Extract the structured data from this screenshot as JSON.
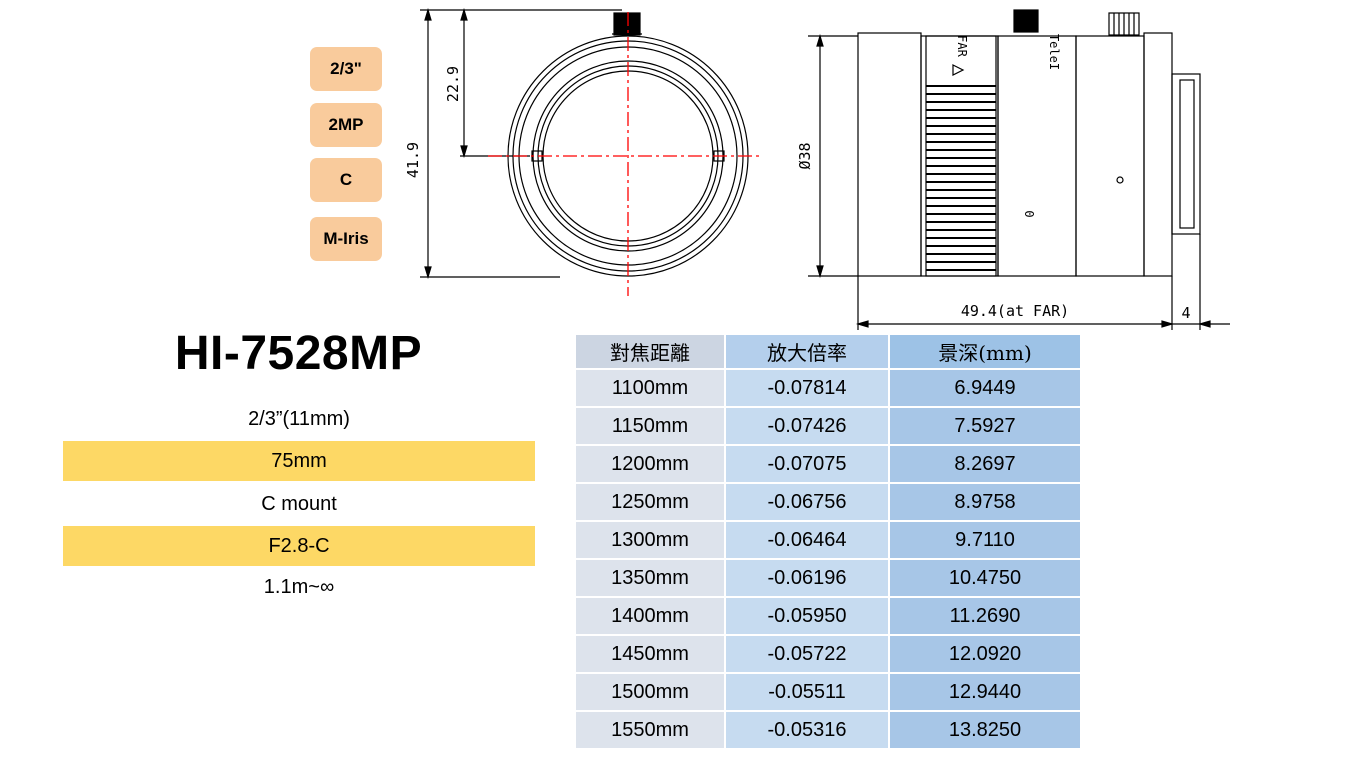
{
  "badges": [
    "2/3\"",
    "2MP",
    "C",
    "M-Iris"
  ],
  "model": "HI-7528MP",
  "specs": [
    "2/3”(11mm)",
    "75mm",
    "C mount",
    "F2.8-C",
    "1.1m~∞"
  ],
  "drawing": {
    "dim_height": "41.9",
    "dim_half_height": "22.9",
    "dim_diameter": "Ø38",
    "dim_length": "49.4(at FAR)",
    "dim_flange": "4",
    "focus_mark": "FAR",
    "iris_mark": "TeleI",
    "zero_mark": "0"
  },
  "table": {
    "headers": [
      "對焦距離",
      "放大倍率",
      "景深(mm)"
    ],
    "rows": [
      [
        "1100mm",
        "-0.07814",
        "6.9449"
      ],
      [
        "1150mm",
        "-0.07426",
        "7.5927"
      ],
      [
        "1200mm",
        "-0.07075",
        "8.2697"
      ],
      [
        "1250mm",
        "-0.06756",
        "8.9758"
      ],
      [
        "1300mm",
        "-0.06464",
        "9.7110"
      ],
      [
        "1350mm",
        "-0.06196",
        "10.4750"
      ],
      [
        "1400mm",
        "-0.05950",
        "11.2690"
      ],
      [
        "1450mm",
        "-0.05722",
        "12.0920"
      ],
      [
        "1500mm",
        "-0.05511",
        "12.9440"
      ],
      [
        "1550mm",
        "-0.05316",
        "13.8250"
      ]
    ]
  },
  "colors": {
    "badge": "#f9cb9c",
    "highlight": "#fdd865",
    "crosshair": "#ff0000",
    "col1": "#dde3ec",
    "col2": "#c6dbf0",
    "col3": "#a7c6e7"
  }
}
